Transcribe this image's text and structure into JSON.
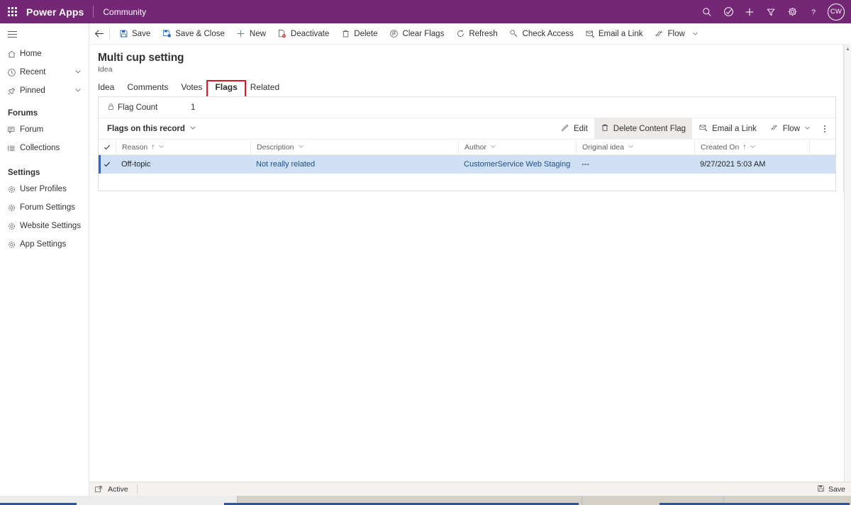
{
  "topbar": {
    "brand": "Power Apps",
    "app_name": "Community",
    "waffle_icon": "waffle-grid-icon",
    "icons": [
      {
        "name": "search-icon",
        "label": "Search"
      },
      {
        "name": "assistant-icon",
        "label": "Assistant"
      },
      {
        "name": "plus-icon",
        "label": "New"
      },
      {
        "name": "filter-icon",
        "label": "Filter"
      },
      {
        "name": "gear-icon",
        "label": "Settings"
      },
      {
        "name": "help-icon",
        "label": "Help"
      }
    ],
    "avatar_initials": "CW",
    "accent_color": "#742774"
  },
  "sidebar": {
    "hamburger_label": "Expand navigation",
    "items": [
      {
        "label": "Home",
        "icon": "home-icon",
        "chevron": false
      },
      {
        "label": "Recent",
        "icon": "clock-icon",
        "chevron": true
      },
      {
        "label": "Pinned",
        "icon": "pin-icon",
        "chevron": true
      }
    ],
    "groups": [
      {
        "title": "Forums",
        "items": [
          {
            "label": "Forum",
            "icon": "forum-icon"
          },
          {
            "label": "Collections",
            "icon": "collections-icon"
          }
        ]
      },
      {
        "title": "Settings",
        "items": [
          {
            "label": "User Profiles",
            "icon": "gear-icon"
          },
          {
            "label": "Forum Settings",
            "icon": "gear-icon"
          },
          {
            "label": "Website Settings",
            "icon": "gear-icon"
          },
          {
            "label": "App Settings",
            "icon": "gear-icon"
          }
        ]
      }
    ]
  },
  "commandbar": {
    "back_label": "Back",
    "buttons": [
      {
        "label": "Save",
        "icon": "save-icon",
        "caret": false
      },
      {
        "label": "Save & Close",
        "icon": "save-close-icon",
        "caret": false
      },
      {
        "label": "New",
        "icon": "plus-icon",
        "caret": false
      },
      {
        "label": "Deactivate",
        "icon": "deactivate-icon",
        "caret": false
      },
      {
        "label": "Delete",
        "icon": "trash-icon",
        "caret": false
      },
      {
        "label": "Clear Flags",
        "icon": "clear-flags-icon",
        "caret": false
      },
      {
        "label": "Refresh",
        "icon": "refresh-icon",
        "caret": false
      },
      {
        "label": "Check Access",
        "icon": "key-icon",
        "caret": false
      },
      {
        "label": "Email a Link",
        "icon": "email-link-icon",
        "caret": false
      },
      {
        "label": "Flow",
        "icon": "flow-icon",
        "caret": true
      }
    ]
  },
  "record": {
    "title": "Multi cup setting",
    "subtitle": "Idea"
  },
  "tabs": [
    {
      "label": "Idea",
      "active": false,
      "highlighted": false
    },
    {
      "label": "Comments",
      "active": false,
      "highlighted": false
    },
    {
      "label": "Votes",
      "active": false,
      "highlighted": false
    },
    {
      "label": "Flags",
      "active": true,
      "highlighted": true
    },
    {
      "label": "Related",
      "active": false,
      "highlighted": false
    }
  ],
  "form": {
    "flag_count_label": "Flag Count",
    "flag_count_icon": "lock-icon",
    "flag_count_value": "1"
  },
  "subgrid": {
    "view_name": "Flags on this record",
    "view_caret_icon": "chevron-down-icon",
    "commands": [
      {
        "label": "Edit",
        "icon": "pencil-icon",
        "selected": false,
        "caret": false
      },
      {
        "label": "Delete Content Flag",
        "icon": "trash-icon",
        "selected": true,
        "caret": false
      },
      {
        "label": "Email a Link",
        "icon": "email-link-icon",
        "selected": false,
        "caret": false
      },
      {
        "label": "Flow",
        "icon": "flow-icon",
        "selected": false,
        "caret": true
      }
    ],
    "overflow_label": "More commands",
    "columns": [
      {
        "label": "Reason",
        "sorted": true,
        "sort_dir": "asc"
      },
      {
        "label": "Description",
        "sorted": false,
        "sort_dir": ""
      },
      {
        "label": "Author",
        "sorted": false,
        "sort_dir": ""
      },
      {
        "label": "Original idea",
        "sorted": false,
        "sort_dir": ""
      },
      {
        "label": "Created On",
        "sorted": true,
        "sort_dir": "asc"
      }
    ],
    "rows": [
      {
        "selected": true,
        "reason": "Off-topic",
        "description": "Not really related",
        "author": "CustomerService Web Staging",
        "original_idea": "---",
        "created_on": "9/27/2021 5:03 AM"
      }
    ]
  },
  "statusbar": {
    "state_icon": "open-record-icon",
    "state_label": "Active",
    "save_label": "Save",
    "save_icon": "save-icon"
  },
  "colors": {
    "brand_purple": "#742774",
    "row_selected": "#cfe0f4",
    "tab_underline": "#2266e3",
    "highlight_box": "#e81123",
    "link_text": "#1f4d87"
  }
}
